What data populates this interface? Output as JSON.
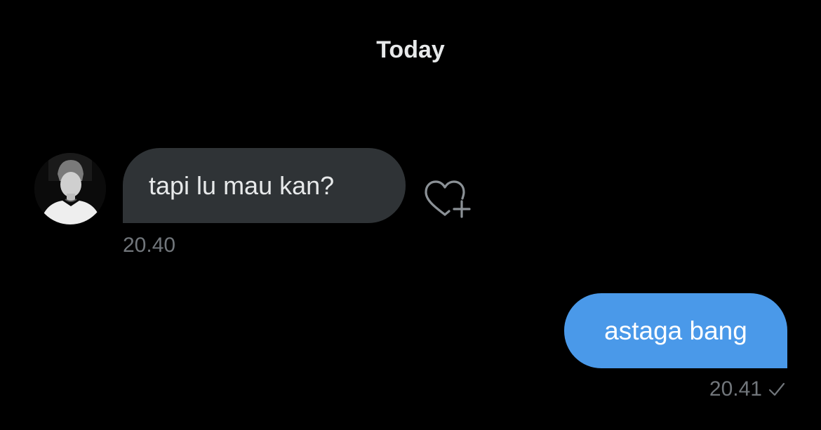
{
  "conversation": {
    "date_divider": "Today",
    "messages": [
      {
        "direction": "incoming",
        "text": "tapi lu mau kan?",
        "time": "20.40",
        "has_avatar": true,
        "reaction_icon": "heart-plus-icon"
      },
      {
        "direction": "outgoing",
        "text": "astaga bang",
        "time": "20.41",
        "status_icon": "check-icon"
      }
    ]
  },
  "colors": {
    "background": "#000000",
    "incoming_bubble": "#2f3336",
    "outgoing_bubble": "#4a99e9",
    "timestamp": "#71767b"
  }
}
